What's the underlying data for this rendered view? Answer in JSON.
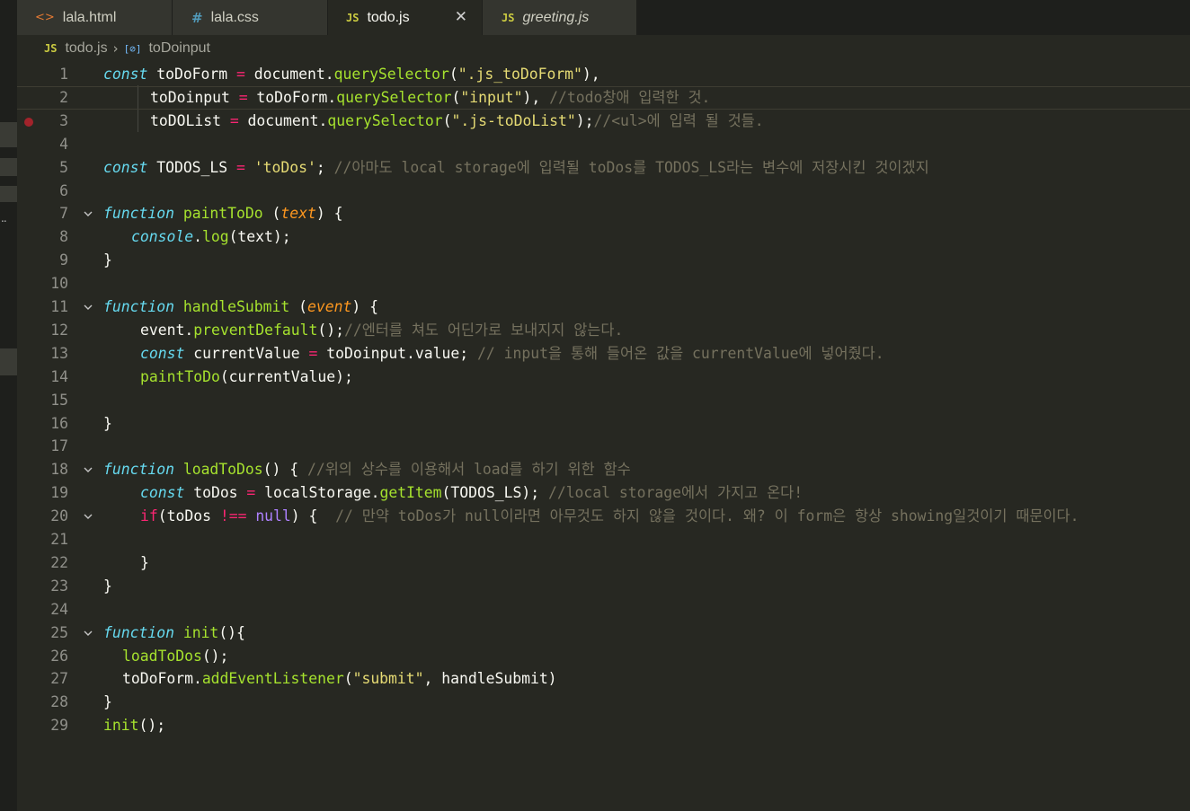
{
  "tabs": [
    {
      "label": "lala.html",
      "icon": "html-file-icon"
    },
    {
      "label": "lala.css",
      "icon": "css-file-icon"
    },
    {
      "label": "todo.js",
      "icon": "js-file-icon",
      "active": true
    },
    {
      "label": "greeting.js",
      "icon": "js-file-icon",
      "preview": true
    }
  ],
  "tab_icons": {
    "html": "<>",
    "css": "#",
    "js": "JS",
    "close": "✕"
  },
  "breadcrumb": {
    "file": "todo.js",
    "separator": "›",
    "symbol_icon": "[⊘]",
    "symbol": "toDoinput"
  },
  "colors": {
    "background": "#272822",
    "keyword": "#66d9ef",
    "function": "#a6e22e",
    "string": "#e6db74",
    "operator": "#f92672",
    "comment": "#75715e",
    "parameter": "#fd971f",
    "breakpoint": "#a2232b"
  },
  "lines": [
    {
      "n": "1",
      "c": "const toDoForm = document.querySelector(\".js_toDoForm\"),"
    },
    {
      "n": "2",
      "c": "toDoinput = toDoForm.querySelector(\"input\"), //todo창애 입력한 것."
    },
    {
      "n": "3",
      "c": "toDOList = document.querySelector(\".js-toDoList\");//<ul>에 입력 될 것들."
    },
    {
      "n": "4",
      "c": ""
    },
    {
      "n": "5",
      "c": "const TODOS_LS = 'toDos'; //아마도 local storage에 입력될 toDos를 TODOS_LS라는 변수에 저장시킨 것이겠지"
    },
    {
      "n": "6",
      "c": ""
    },
    {
      "n": "7",
      "c": "function paintToDo (text) {"
    },
    {
      "n": "8",
      "c": "console.log(text);"
    },
    {
      "n": "9",
      "c": "}"
    },
    {
      "n": "10",
      "c": ""
    },
    {
      "n": "11",
      "c": "function handleSubmit (event) {"
    },
    {
      "n": "12",
      "c": "event.preventDefault();//엔터를 쳐도 어딘가로 보내지지 않는다."
    },
    {
      "n": "13",
      "c": "const currentValue = toDoinput.value; // input을 통해 들어온 값을 currentValue에 넣어줬다."
    },
    {
      "n": "14",
      "c": "paintToDo(currentValue);"
    },
    {
      "n": "15",
      "c": ""
    },
    {
      "n": "16",
      "c": "}"
    },
    {
      "n": "17",
      "c": ""
    },
    {
      "n": "18",
      "c": "function loadToDos() { //위의 상수를 이용해서 load를 하기 위한 함수"
    },
    {
      "n": "19",
      "c": "const toDos = localStorage.getItem(TODOS_LS); //local storage에서 가지고 온다!"
    },
    {
      "n": "20",
      "c": "if(toDos !== null) {  // 만약 toDos가 null이라면 아무것도 하지 않을 것이다. 왜? 이 form은 항상 showing일것이기 때문이다."
    },
    {
      "n": "21",
      "c": ""
    },
    {
      "n": "22",
      "c": "}"
    },
    {
      "n": "23",
      "c": "}"
    },
    {
      "n": "24",
      "c": ""
    },
    {
      "n": "25",
      "c": "function init(){"
    },
    {
      "n": "26",
      "c": "loadToDos();"
    },
    {
      "n": "27",
      "c": "toDoForm.addEventListener(\"submit\", handleSubmit)"
    },
    {
      "n": "28",
      "c": "}"
    },
    {
      "n": "29",
      "c": "init();"
    }
  ]
}
